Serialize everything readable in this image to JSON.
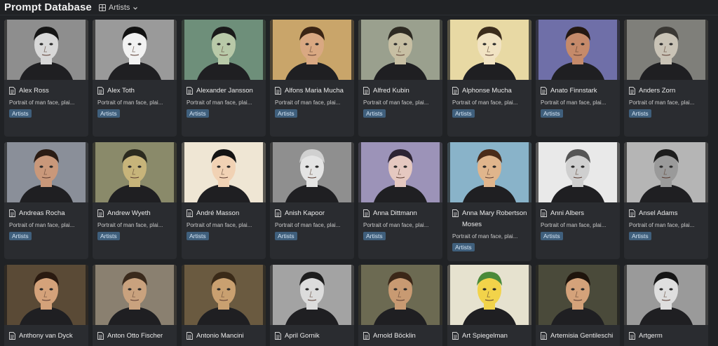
{
  "header": {
    "title": "Prompt Database",
    "view_label": "Artists"
  },
  "cards": [
    {
      "name": "Alex Ross",
      "desc": "Portrait of man face, plai...",
      "tag": "Artists",
      "bg": "#8e8e8e",
      "skin": "#d8d8d8",
      "hair": "#151515"
    },
    {
      "name": "Alex Toth",
      "desc": "Portrait of man face, plai...",
      "tag": "Artists",
      "bg": "#9a9a9a",
      "skin": "#f2f2f2",
      "hair": "#111111"
    },
    {
      "name": "Alexander Jansson",
      "desc": "Portrait of man face, plai...",
      "tag": "Artists",
      "bg": "#6e8f7a",
      "skin": "#b8c9a8",
      "hair": "#1a1a1a"
    },
    {
      "name": "Alfons Maria Mucha",
      "desc": "Portrait of man face, plai...",
      "tag": "Artists",
      "bg": "#c9a56a",
      "skin": "#d9a882",
      "hair": "#3a2414"
    },
    {
      "name": "Alfred Kubin",
      "desc": "Portrait of man face, plai...",
      "tag": "Artists",
      "bg": "#9aa08e",
      "skin": "#c7bfa3",
      "hair": "#2d2a22"
    },
    {
      "name": "Alphonse Mucha",
      "desc": "Portrait of man face, plai...",
      "tag": "Artists",
      "bg": "#e8d9a4",
      "skin": "#f1e3c3",
      "hair": "#3b2c1c"
    },
    {
      "name": "Anato Finnstark",
      "desc": "Portrait of man face, plai...",
      "tag": "Artists",
      "bg": "#6f6fa8",
      "skin": "#c58a6a",
      "hair": "#241812"
    },
    {
      "name": "Anders Zorn",
      "desc": "Portrait of man face, plai...",
      "tag": "Artists",
      "bg": "#7f7f7a",
      "skin": "#c9c3b6",
      "hair": "#3a3834"
    },
    {
      "name": "Andreas Rocha",
      "desc": "Portrait of man face, plai...",
      "tag": "Artists",
      "bg": "#8a8f99",
      "skin": "#c9987a",
      "hair": "#2a1c14"
    },
    {
      "name": "Andrew Wyeth",
      "desc": "Portrait of man face, plai...",
      "tag": "Artists",
      "bg": "#8a8a6a",
      "skin": "#c7b47a",
      "hair": "#2b2a1f"
    },
    {
      "name": "André Masson",
      "desc": "Portrait of man face, plai...",
      "tag": "Artists",
      "bg": "#efe6d4",
      "skin": "#f1d2b4",
      "hair": "#141414"
    },
    {
      "name": "Anish Kapoor",
      "desc": "Portrait of man face, plai...",
      "tag": "Artists",
      "bg": "#8f8f8f",
      "skin": "#e4e4e4",
      "hair": "#d0d0d0"
    },
    {
      "name": "Anna Dittmann",
      "desc": "Portrait of man face, plai...",
      "tag": "Artists",
      "bg": "#9c93b8",
      "skin": "#e5c8c0",
      "hair": "#2d2433"
    },
    {
      "name": "Anna Mary Robertson Moses",
      "desc": "Portrait of man face, plai...",
      "tag": "Artists",
      "bg": "#89b3c9",
      "skin": "#e0b58c",
      "hair": "#4a2c1a"
    },
    {
      "name": "Anni Albers",
      "desc": "Portrait of man face, plai...",
      "tag": "Artists",
      "bg": "#e9e9e9",
      "skin": "#cfcfcf",
      "hair": "#555555"
    },
    {
      "name": "Ansel Adams",
      "desc": "Portrait of man face, plai...",
      "tag": "Artists",
      "bg": "#b5b5b5",
      "skin": "#9a9a9a",
      "hair": "#1c1c1c"
    },
    {
      "name": "Anthony van Dyck",
      "desc": "",
      "tag": "",
      "bg": "#5a4a36",
      "skin": "#d4a27a",
      "hair": "#2a1a10"
    },
    {
      "name": "Anton Otto Fischer",
      "desc": "",
      "tag": "",
      "bg": "#8a8070",
      "skin": "#c9a27e",
      "hair": "#3a2a1c"
    },
    {
      "name": "Antonio Mancini",
      "desc": "",
      "tag": "",
      "bg": "#6a5a40",
      "skin": "#c9a070",
      "hair": "#3a2a18"
    },
    {
      "name": "April Gornik",
      "desc": "",
      "tag": "",
      "bg": "#a3a3a3",
      "skin": "#dcdcdc",
      "hair": "#1d1d1d"
    },
    {
      "name": "Arnold Böcklin",
      "desc": "",
      "tag": "",
      "bg": "#6c6a52",
      "skin": "#c89a72",
      "hair": "#3b2718"
    },
    {
      "name": "Art Spiegelman",
      "desc": "",
      "tag": "",
      "bg": "#e6e2cf",
      "skin": "#f2d34a",
      "hair": "#4a8a3a"
    },
    {
      "name": "Artemisia Gentileschi",
      "desc": "",
      "tag": "",
      "bg": "#4a4a3a",
      "skin": "#d4a27a",
      "hair": "#1e140c"
    },
    {
      "name": "Artgerm",
      "desc": "",
      "tag": "",
      "bg": "#9a9a9a",
      "skin": "#dedede",
      "hair": "#151515"
    }
  ]
}
